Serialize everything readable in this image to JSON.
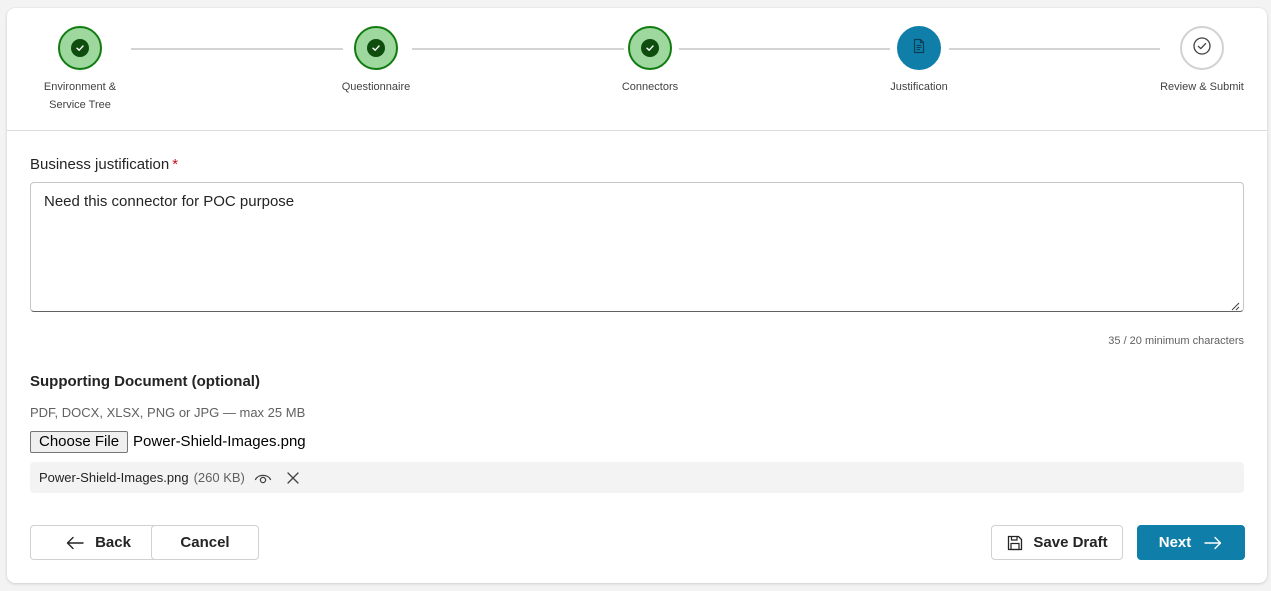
{
  "stepper": {
    "steps": [
      {
        "label_line1": "Environment &",
        "label_line2": "Service Tree",
        "state": "completed",
        "icon": "checkmark-icon"
      },
      {
        "label_line1": "Questionnaire",
        "state": "completed",
        "icon": "checkmark-icon"
      },
      {
        "label_line1": "Connectors",
        "state": "completed",
        "icon": "checkmark-icon"
      },
      {
        "label_line1": "Justification",
        "state": "current",
        "icon": "document-icon"
      },
      {
        "label_line1": "Review & Submit",
        "state": "pending",
        "icon": "check-circle-icon"
      }
    ]
  },
  "justification": {
    "label": "Business justification",
    "required_marker": "*",
    "value": "Need this connector for POC purpose",
    "char_count": "35 / 20 minimum characters"
  },
  "supporting_document": {
    "title": "Supporting Document (optional)",
    "hint": "PDF, DOCX, XLSX, PNG or JPG — max 25 MB",
    "choose_button_label": "Choose File",
    "chosen_file": "Power-Shield-Images.png",
    "attachment": {
      "name": "Power-Shield-Images.png",
      "size": "(260 KB)",
      "view_icon": "eye-icon",
      "remove_icon": "close-icon"
    }
  },
  "actions": {
    "back_label": "Back",
    "cancel_label": "Cancel",
    "save_draft_label": "Save Draft",
    "next_label": "Next"
  },
  "colors": {
    "accent": "#0f7ea8",
    "completed_fill": "#9fd89f",
    "completed_border": "#107c10",
    "required": "#c50f1f"
  }
}
